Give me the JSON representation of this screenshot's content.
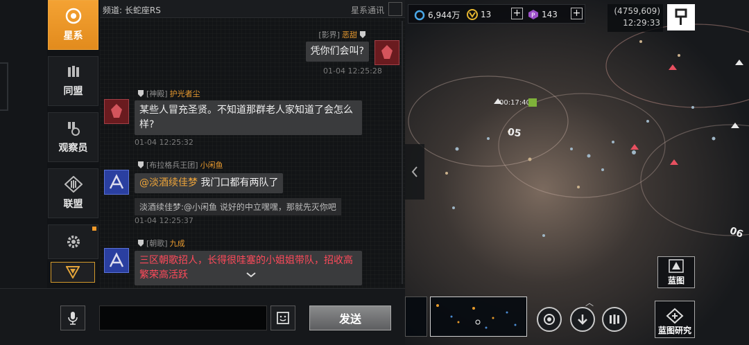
{
  "side_tabs": [
    {
      "label": "星系",
      "icon": "galaxy-icon",
      "active": true
    },
    {
      "label": "同盟",
      "icon": "alliance-icon",
      "active": false
    },
    {
      "label": "观察员",
      "icon": "observer-icon",
      "active": false
    },
    {
      "label": "联盟",
      "icon": "league-icon",
      "active": false
    },
    {
      "label": "",
      "icon": "settings-icon",
      "active": false
    }
  ],
  "chat": {
    "channel": "频道: 长蛇座RS",
    "comms_label": "星系通讯",
    "messages": [
      {
        "tag": "[影界]",
        "nick": "恶甜",
        "text": "凭你们会叫?",
        "time": "01-04 12:25:28"
      },
      {
        "tag": "[神殿]",
        "nick": "护光者尘",
        "text_line1": "某些人冒充圣贤。不知道那群老人家知道了会怎么",
        "text_line2": "样?",
        "time": "01-04 12:25:32"
      },
      {
        "tag": "[布拉格兵王团]",
        "nick": "小闲鱼",
        "mention": "@淡酒续佳梦",
        "text": " 我门口都有两队了",
        "quote": "淡酒续佳梦:@小闲鱼 说好的中立嘿嘿，那就先灭你吧",
        "time": "01-04 12:25:37"
      },
      {
        "tag": "[朝歌]",
        "nick": "九成",
        "text_line1": "三区朝歌招人，长得很哇塞的小姐姐带队，招收高",
        "text_line2": "繁荣高活跃"
      }
    ]
  },
  "input": {
    "placeholder": "",
    "send_label": "发送"
  },
  "map": {
    "resources": {
      "credits": "6,944万",
      "gold": "13",
      "crystal": "143"
    },
    "coords": "(4759,609)",
    "clock": "12:29:33",
    "sectors": [
      "05",
      "06"
    ],
    "fleet_timer": "00:17:40",
    "blueprint_label": "蓝图",
    "blueprint_research_label": "蓝图研究"
  },
  "colors": {
    "accent": "#f29a2a",
    "alert_text": "#ff4a5a",
    "nick": "#e99a2e"
  }
}
